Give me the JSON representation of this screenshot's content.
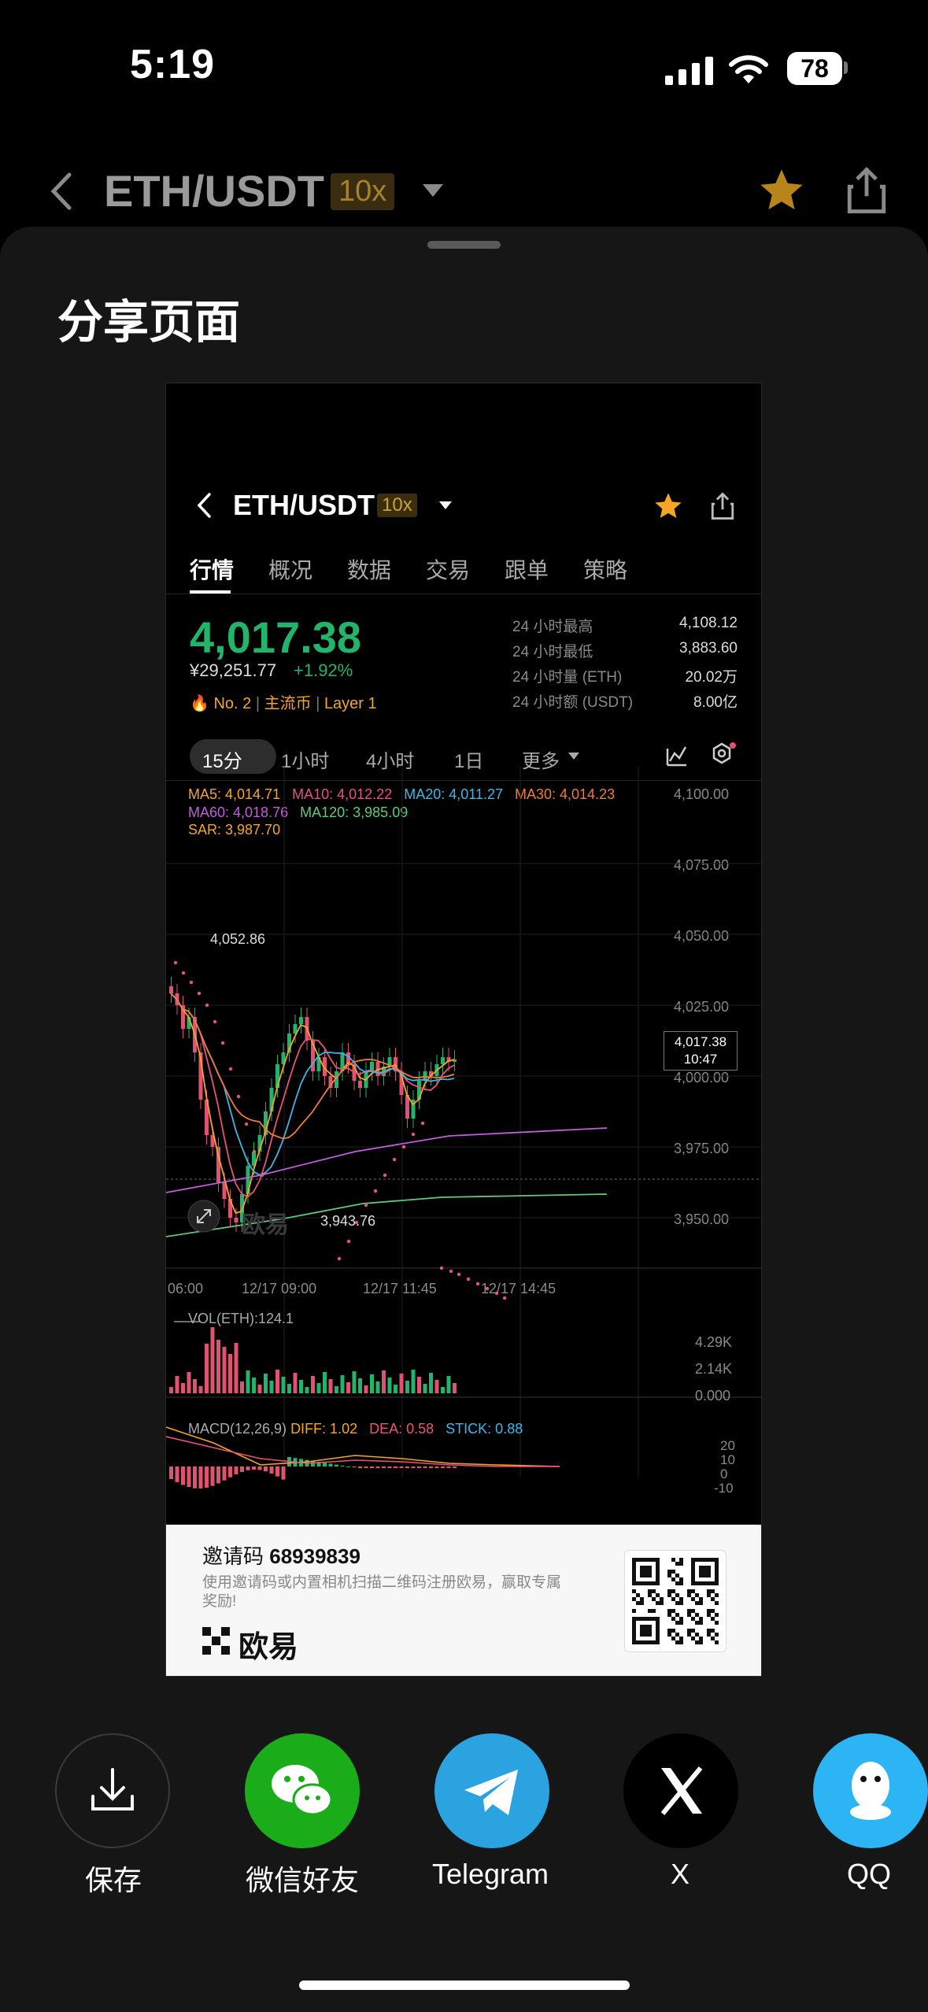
{
  "status_bar": {
    "time": "5:19",
    "battery": "78"
  },
  "app_header": {
    "pair": "ETH/USDT",
    "leverage": "10x"
  },
  "sheet": {
    "title": "分享页面"
  },
  "card": {
    "pair": "ETH/USDT",
    "leverage": "10x",
    "tabs": [
      "行情",
      "概况",
      "数据",
      "交易",
      "跟单",
      "策略"
    ],
    "price": "4,017.38",
    "price_cny": "¥29,251.77",
    "change_pct": "+1.92%",
    "tags": {
      "rank": "No. 2",
      "category": "主流币",
      "layer": "Layer 1"
    },
    "stats": [
      {
        "label": "24 小时最高",
        "value": "4,108.12"
      },
      {
        "label": "24 小时最低",
        "value": "3,883.60"
      },
      {
        "label": "24 小时量 (ETH)",
        "value": "20.02万"
      },
      {
        "label": "24 小时额 (USDT)",
        "value": "8.00亿"
      }
    ],
    "intervals": [
      "15分",
      "1小时",
      "4小时",
      "1日",
      "更多"
    ],
    "indicators": {
      "ma5": "MA5: 4,014.71",
      "ma10": "MA10: 4,012.22",
      "ma20": "MA20: 4,011.27",
      "ma30": "MA30: 4,014.23",
      "ma60": "MA60: 4,018.76",
      "ma120": "MA120: 3,985.09",
      "sar": "SAR: 3,987.70"
    },
    "y_axis": [
      "4,100.00",
      "4,075.00",
      "4,050.00",
      "4,025.00",
      "4,000.00",
      "3,975.00",
      "3,950.00"
    ],
    "x_axis": [
      "06:00",
      "12/17 09:00",
      "12/17 11:45",
      "12/17 14:45"
    ],
    "high_annotation": "4,052.86",
    "low_annotation": "3,943.76",
    "watermark": "欧易",
    "last_price_tag": {
      "price": "4,017.38",
      "countdown": "10:47"
    },
    "vol": {
      "label": "VOL(ETH):124.1",
      "axis": [
        "4.29K",
        "2.14K",
        "0.000"
      ]
    },
    "macd": {
      "label": "MACD(12,26,9)",
      "diff": "DIFF: 1.02",
      "dea": "DEA: 0.58",
      "stick": "STICK: 0.88",
      "axis": [
        "20",
        "10",
        "0",
        "-10"
      ]
    },
    "invite": {
      "code_label": "邀请码",
      "code": "68939839",
      "desc": "使用邀请码或内置相机扫描二维码注册欧易，赢取专属奖励!",
      "logo": "欧易"
    }
  },
  "share_targets": [
    {
      "label": "保存",
      "icon": "download-icon",
      "color": "#161616"
    },
    {
      "label": "微信好友",
      "icon": "wechat-icon",
      "color": "#1aad19"
    },
    {
      "label": "Telegram",
      "icon": "telegram-icon",
      "color": "#2aa3e0"
    },
    {
      "label": "X",
      "icon": "x-icon",
      "color": "#000000"
    },
    {
      "label": "QQ",
      "icon": "qq-icon",
      "color": "#2db4f5"
    }
  ],
  "colors": {
    "up": "#22b46a",
    "down": "#e05270",
    "accent": "#f5a623"
  }
}
